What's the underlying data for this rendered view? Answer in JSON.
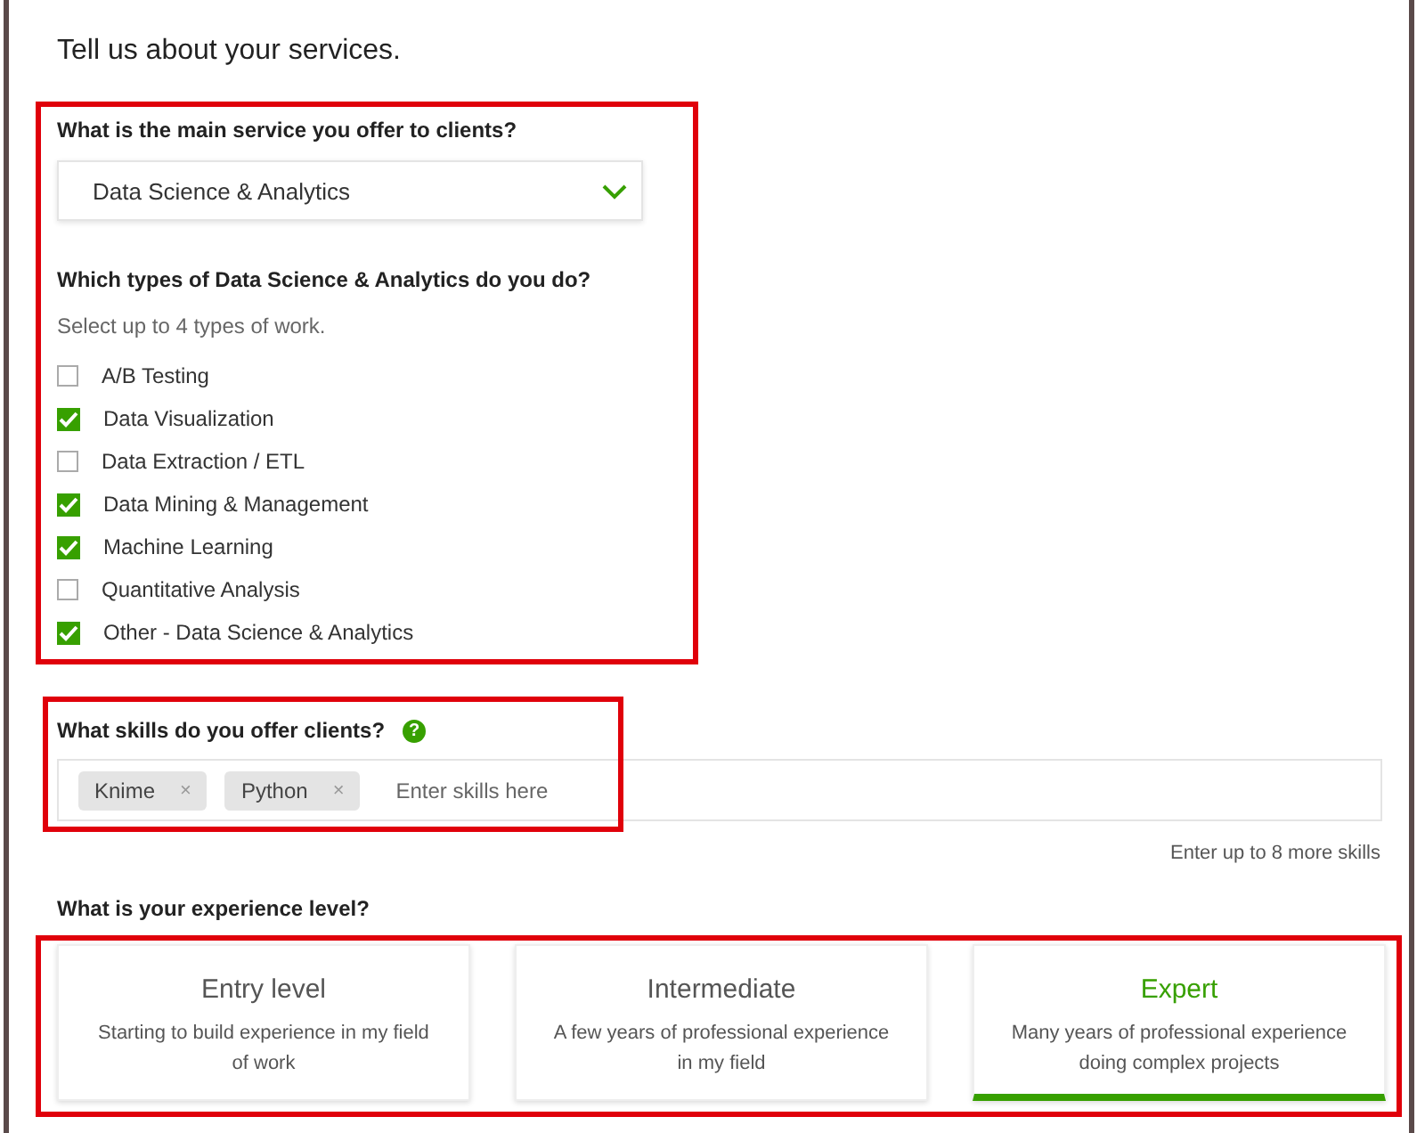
{
  "title": "Tell us about your services.",
  "service": {
    "highlighted": true,
    "label": "What is the main service you offer to clients?",
    "value": "Data Science & Analytics",
    "types_label": "Which types of Data Science & Analytics do you do?",
    "hint": "Select up to 4 types of work.",
    "options": [
      {
        "label": "A/B Testing",
        "checked": false
      },
      {
        "label": "Data Visualization",
        "checked": true
      },
      {
        "label": "Data Extraction / ETL",
        "checked": false
      },
      {
        "label": "Data Mining & Management",
        "checked": true
      },
      {
        "label": "Machine Learning",
        "checked": true
      },
      {
        "label": "Quantitative Analysis",
        "checked": false
      },
      {
        "label": "Other - Data Science & Analytics",
        "checked": true
      }
    ]
  },
  "skills": {
    "highlighted": true,
    "label": "What skills do you offer clients?",
    "help": "?",
    "tags": [
      {
        "label": "Knime",
        "remove": "×"
      },
      {
        "label": "Python",
        "remove": "×"
      }
    ],
    "placeholder": "Enter skills here",
    "hint": "Enter up to 8 more skills"
  },
  "experience": {
    "highlighted": true,
    "label": "What is your experience level?",
    "levels": [
      {
        "title": "Entry level",
        "description": "Starting to build experience in my field of work",
        "selected": false
      },
      {
        "title": "Intermediate",
        "description": "A few years of professional experience in my field",
        "selected": false
      },
      {
        "title": "Expert",
        "description": "Many years of professional experience doing complex projects",
        "selected": true
      }
    ]
  }
}
